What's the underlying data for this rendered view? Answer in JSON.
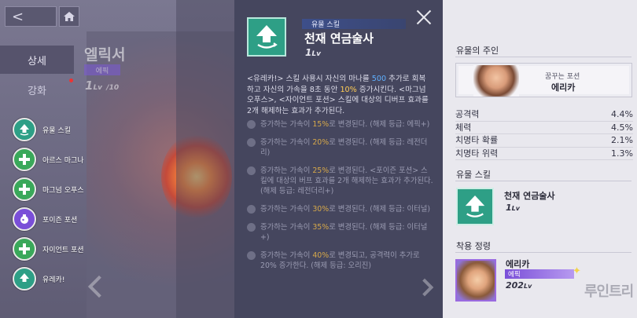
{
  "nav": {
    "back_label": "<",
    "home_icon": "home-icon"
  },
  "tabs": [
    {
      "label": "상세"
    },
    {
      "label": "강화"
    }
  ],
  "relic_bg": {
    "name": "엘릭서",
    "grade": "에픽",
    "level": "1",
    "level_unit": "Lv",
    "level_max": "/10"
  },
  "skill_list": [
    {
      "label": "유물 스킬",
      "icon": "arrow-up-icon",
      "color": "#2e9f86"
    },
    {
      "label": "아르스 마그나",
      "icon": "plus-icon",
      "color": "#3aa85a"
    },
    {
      "label": "마그넘 오푸스",
      "icon": "plus-icon",
      "color": "#3aa85a"
    },
    {
      "label": "포이즌 포션",
      "icon": "poison-icon",
      "color": "#7a4fd8"
    },
    {
      "label": "자이언트 포션",
      "icon": "plus-icon",
      "color": "#3aa85a"
    },
    {
      "label": "유레카!",
      "icon": "arrow-up-icon",
      "color": "#2e9f86"
    }
  ],
  "popup": {
    "tag": "유물 스킬",
    "title": "천재 연금술사",
    "level": "1",
    "level_unit": "Lv",
    "desc_a": "<유레카!> 스킬 사용시 자신의 마나를 ",
    "desc_b": "500",
    "desc_c": " 추가로 회복하고 자신의 가속을 8초 동안 ",
    "desc_d": "10%",
    "desc_e": " 증가시킨다. <마그넘 오푸스>, <자이언트 포션> 스킬에 대상의 디버프 효과를 2개 해제하는 효과가 추가된다.",
    "steps": [
      {
        "pre": "증가하는 가속이 ",
        "val": "15%",
        "post": "로 변경된다. (해제 등급: 에픽+)"
      },
      {
        "pre": "증가하는 가속이 ",
        "val": "20%",
        "post": "로 변경된다. (해제 등급: 레전더리)"
      },
      {
        "pre": "증가하는 가속이 ",
        "val": "25%",
        "post": "로 변경된다. <포이즌 포션> 스킬에 대상의 버프 효과를 2개 해제하는 효과가 추가된다. (해제 등급: 레전더리+)"
      },
      {
        "pre": "증가하는 가속이 ",
        "val": "30%",
        "post": "로 변경된다. (해제 등급: 이터널)"
      },
      {
        "pre": "증가하는 가속이 ",
        "val": "35%",
        "post": "로 변경된다. (해제 등급: 이터널+)"
      },
      {
        "pre": "증가하는 가속이 ",
        "val": "40%",
        "post": "로 변경되고, 공격력이 추가로 20% 증가한다. (해제 등급: 오리진)"
      }
    ]
  },
  "right_panel": {
    "owner_title": "유물의 주인",
    "owner_sub": "꿈꾸는 포션",
    "owner_name": "에리카",
    "stats": [
      {
        "label": "공격력",
        "value": "4.4%"
      },
      {
        "label": "체력",
        "value": "4.5%"
      },
      {
        "label": "치명타 확률",
        "value": "2.1%"
      },
      {
        "label": "치명타 위력",
        "value": "1.3%"
      }
    ],
    "relic_skill_title": "유물 스킬",
    "relic_skill_name": "천재 연금술사",
    "relic_skill_level": "1",
    "relic_skill_unit": "Lv",
    "spirit_title": "착용 정령",
    "spirit_name": "에리카",
    "spirit_grade": "에픽",
    "spirit_level": "202",
    "spirit_unit": "Lv",
    "watermark": "루인트리"
  }
}
